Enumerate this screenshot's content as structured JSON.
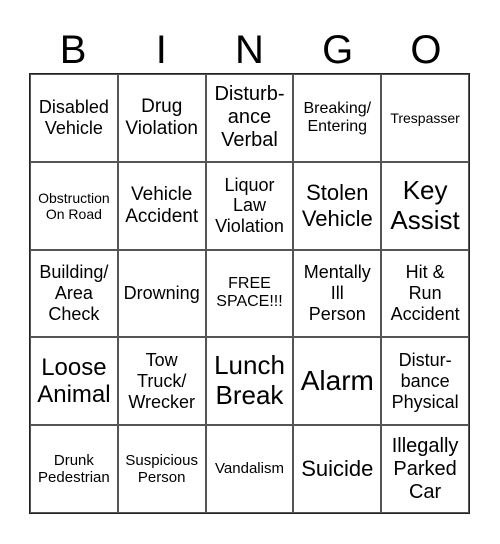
{
  "header": [
    "B",
    "I",
    "N",
    "G",
    "O"
  ],
  "cells": [
    {
      "text": "Disabled\nVehicle",
      "size": "s18"
    },
    {
      "text": "Drug\nViolation",
      "size": "s19"
    },
    {
      "text": "Disturb-\nance\nVerbal",
      "size": "s20"
    },
    {
      "text": "Breaking/\nEntering",
      "size": "s16"
    },
    {
      "text": "Trespasser",
      "size": "s14"
    },
    {
      "text": "Obstruction\nOn Road",
      "size": "s14"
    },
    {
      "text": "Vehicle\nAccident",
      "size": "s19"
    },
    {
      "text": "Liquor\nLaw\nViolation",
      "size": "s18"
    },
    {
      "text": "Stolen\nVehicle",
      "size": "s22"
    },
    {
      "text": "Key\nAssist",
      "size": "s26"
    },
    {
      "text": "Building/\nArea\nCheck",
      "size": "s18"
    },
    {
      "text": "Drowning",
      "size": "s18"
    },
    {
      "text": "FREE\nSPACE!!!",
      "size": "s16"
    },
    {
      "text": "Mentally\nIll\nPerson",
      "size": "s18"
    },
    {
      "text": "Hit &\nRun\nAccident",
      "size": "s18"
    },
    {
      "text": "Loose\nAnimal",
      "size": "s24"
    },
    {
      "text": "Tow\nTruck/\nWrecker",
      "size": "s18"
    },
    {
      "text": "Lunch\nBreak",
      "size": "s26"
    },
    {
      "text": "Alarm",
      "size": "s28"
    },
    {
      "text": "Distur-\nbance\nPhysical",
      "size": "s18"
    },
    {
      "text": "Drunk\nPedestrian",
      "size": "s15"
    },
    {
      "text": "Suspicious\nPerson",
      "size": "s15"
    },
    {
      "text": "Vandalism",
      "size": "s15"
    },
    {
      "text": "Suicide",
      "size": "s22"
    },
    {
      "text": "Illegally\nParked\nCar",
      "size": "s20"
    }
  ]
}
